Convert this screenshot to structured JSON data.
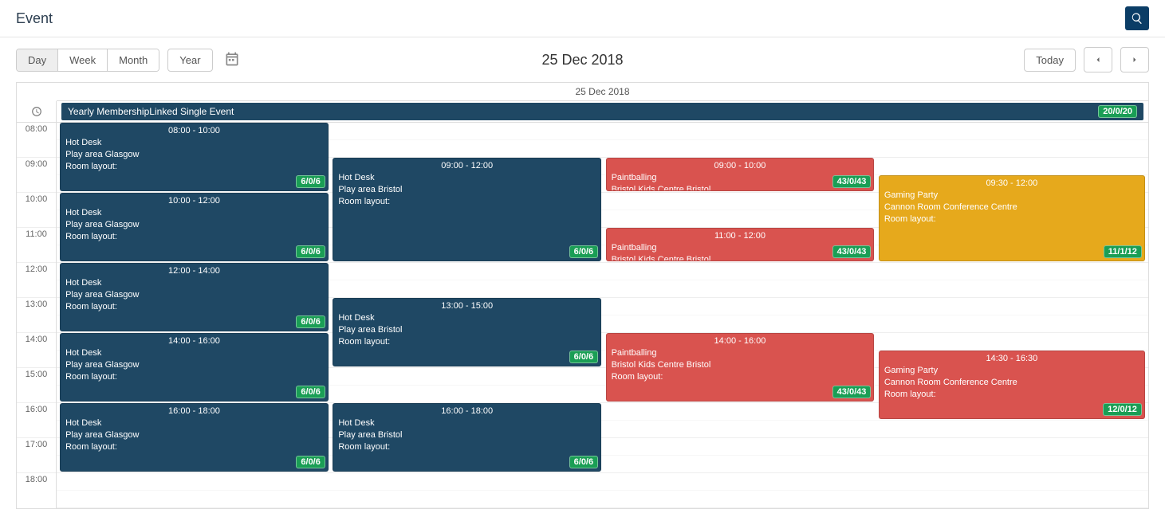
{
  "page_title": "Event",
  "date_title": "25 Dec 2018",
  "day_header": "25 Dec 2018",
  "allday": {
    "title": "Yearly MembershipLinked Single Event",
    "badge": "20/0/20"
  },
  "views": {
    "day": "Day",
    "week": "Week",
    "month": "Month",
    "year": "Year"
  },
  "nav": {
    "today": "Today"
  },
  "hours": [
    "08:00",
    "09:00",
    "10:00",
    "11:00",
    "12:00",
    "13:00",
    "14:00",
    "15:00",
    "16:00",
    "17:00",
    "18:00"
  ],
  "events": {
    "e1": {
      "time": "08:00 - 10:00",
      "title": "Hot Desk",
      "loc": "Play area Glasgow",
      "layout": "Room layout:",
      "badge": "6/0/6"
    },
    "e2": {
      "time": "10:00 - 12:00",
      "title": "Hot Desk",
      "loc": "Play area Glasgow",
      "layout": "Room layout:",
      "badge": "6/0/6"
    },
    "e3": {
      "time": "12:00 - 14:00",
      "title": "Hot Desk",
      "loc": "Play area Glasgow",
      "layout": "Room layout:",
      "badge": "6/0/6"
    },
    "e4": {
      "time": "14:00 - 16:00",
      "title": "Hot Desk",
      "loc": "Play area Glasgow",
      "layout": "Room layout:",
      "badge": "6/0/6"
    },
    "e5": {
      "time": "16:00 - 18:00",
      "title": "Hot Desk",
      "loc": "Play area Glasgow",
      "layout": "Room layout:",
      "badge": "6/0/6"
    },
    "e6": {
      "time": "09:00 - 12:00",
      "title": "Hot Desk",
      "loc": "Play area Bristol",
      "layout": "Room layout:",
      "badge": "6/0/6"
    },
    "e7": {
      "time": "13:00 - 15:00",
      "title": "Hot Desk",
      "loc": "Play area Bristol",
      "layout": "Room layout:",
      "badge": "6/0/6"
    },
    "e8": {
      "time": "16:00 - 18:00",
      "title": "Hot Desk",
      "loc": "Play area Bristol",
      "layout": "Room layout:",
      "badge": "6/0/6"
    },
    "e9": {
      "time": "09:00 - 10:00",
      "title": "Paintballing",
      "loc": "Bristol Kids Centre Bristol",
      "badge": "43/0/43"
    },
    "e10": {
      "time": "11:00 - 12:00",
      "title": "Paintballing",
      "loc": "Bristol Kids Centre Bristol",
      "badge": "43/0/43"
    },
    "e11": {
      "time": "14:00 - 16:00",
      "title": "Paintballing",
      "loc": "Bristol Kids Centre Bristol",
      "layout": "Room layout:",
      "badge": "43/0/43"
    },
    "e12": {
      "time": "09:30 - 12:00",
      "title": "Gaming Party",
      "loc": "Cannon Room Conference Centre",
      "layout": "Room layout:",
      "badge": "11/1/12"
    },
    "e13": {
      "time": "14:30 - 16:30",
      "title": "Gaming Party",
      "loc": "Cannon Room Conference Centre",
      "layout": "Room layout:",
      "badge": "12/0/12"
    }
  }
}
